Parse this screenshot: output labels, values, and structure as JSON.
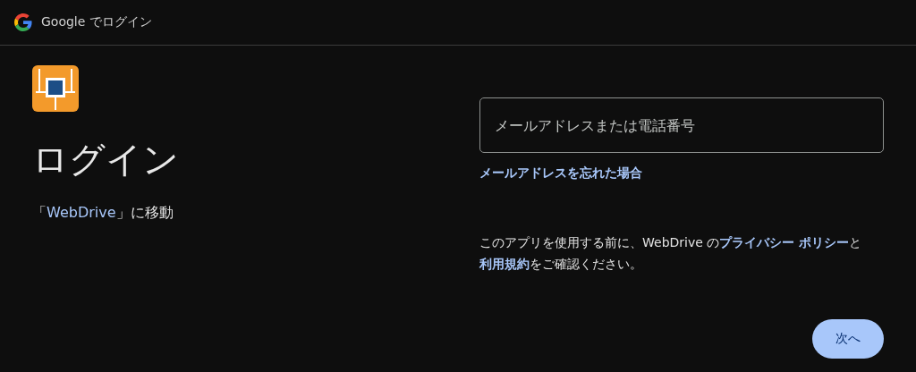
{
  "header": {
    "title": "Google でログイン"
  },
  "app": {
    "heading": "ログイン",
    "subtitle": [
      {
        "kind": "text",
        "text": "「"
      },
      {
        "kind": "link",
        "text": "WebDrive"
      },
      {
        "kind": "text",
        "text": "」に移動"
      }
    ]
  },
  "email_field": {
    "placeholder": "メールアドレスまたは電話番号"
  },
  "forgot_link": "メールアドレスを忘れた場合",
  "notice": [
    {
      "kind": "text",
      "text": "このアプリを使用する前に、WebDrive の"
    },
    {
      "kind": "link",
      "text": "プライバシー ポリシー"
    },
    {
      "kind": "text",
      "text": "と"
    },
    {
      "kind": "link",
      "text": "利用規約"
    },
    {
      "kind": "text",
      "text": "をご確認ください。"
    }
  ],
  "next_button": "次へ"
}
